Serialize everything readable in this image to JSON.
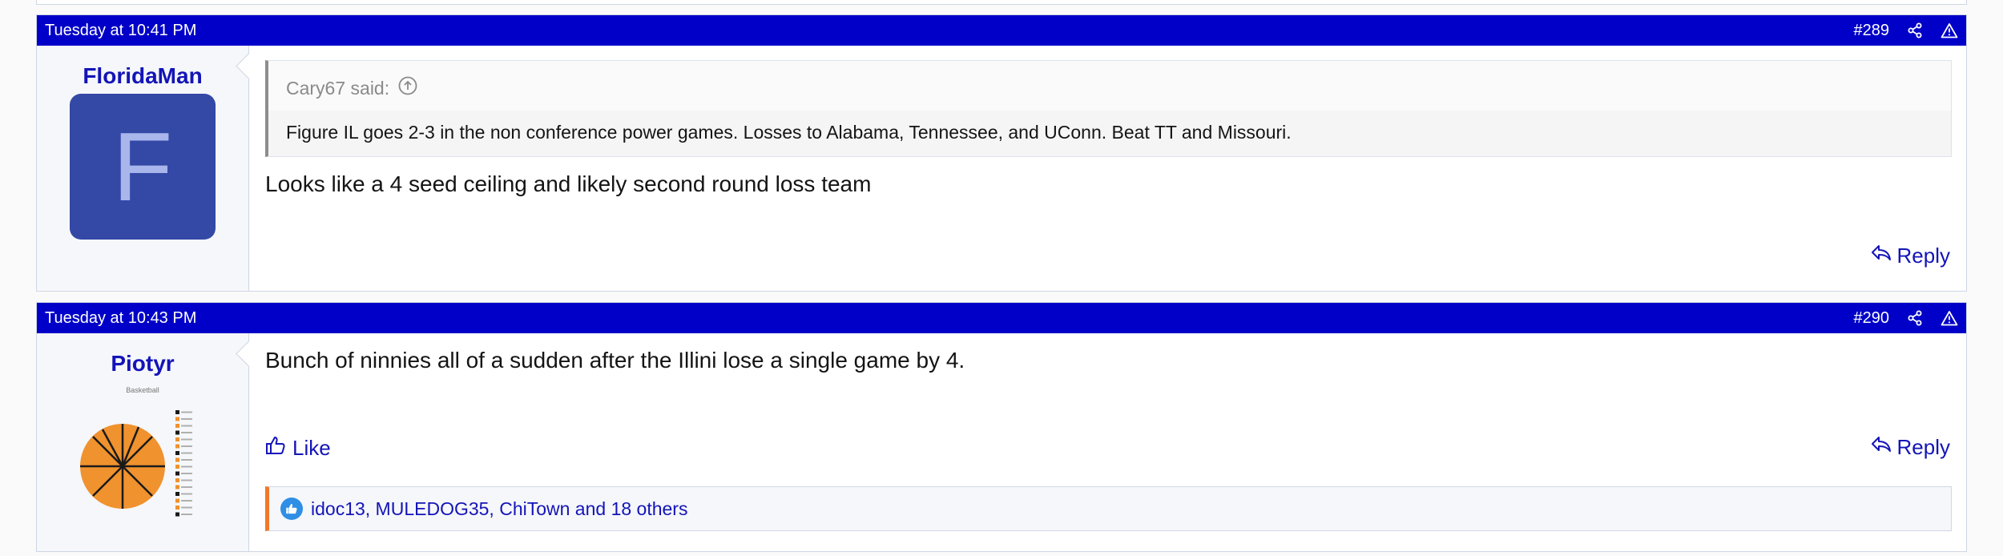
{
  "colors": {
    "header_bg": "#0000c8",
    "link": "#1414b8",
    "avatar_bg": "#3448a6",
    "reaction_accent": "#f0782a",
    "basketball": "#f0922e"
  },
  "posts": [
    {
      "timestamp": "Tuesday at 10:41 PM",
      "number": "#289",
      "username": "FloridaMan",
      "avatar_letter": "F",
      "quote": {
        "author_line": "Cary67 said:",
        "text": "Figure IL goes 2-3 in the non conference power games. Losses to Alabama, Tennessee, and UConn. Beat TT and Missouri."
      },
      "message": "Looks like a 4 seed ceiling and likely second round loss team",
      "reply_label": "Reply",
      "icons": [
        "share-icon",
        "report-icon",
        "arrow-up-circle-icon",
        "reply-icon"
      ]
    },
    {
      "timestamp": "Tuesday at 10:43 PM",
      "number": "#290",
      "username": "Piotyr",
      "user_title": "Basketball",
      "message": "Bunch of ninnies all of a sudden after the Illini lose a single game by 4.",
      "like_label": "Like",
      "reply_label": "Reply",
      "reactions_text": "idoc13, MULEDOG35, ChiTown and 18 others",
      "icons": [
        "share-icon",
        "report-icon",
        "thumbs-up-icon",
        "reply-icon",
        "basketball-pie-icon"
      ]
    }
  ]
}
